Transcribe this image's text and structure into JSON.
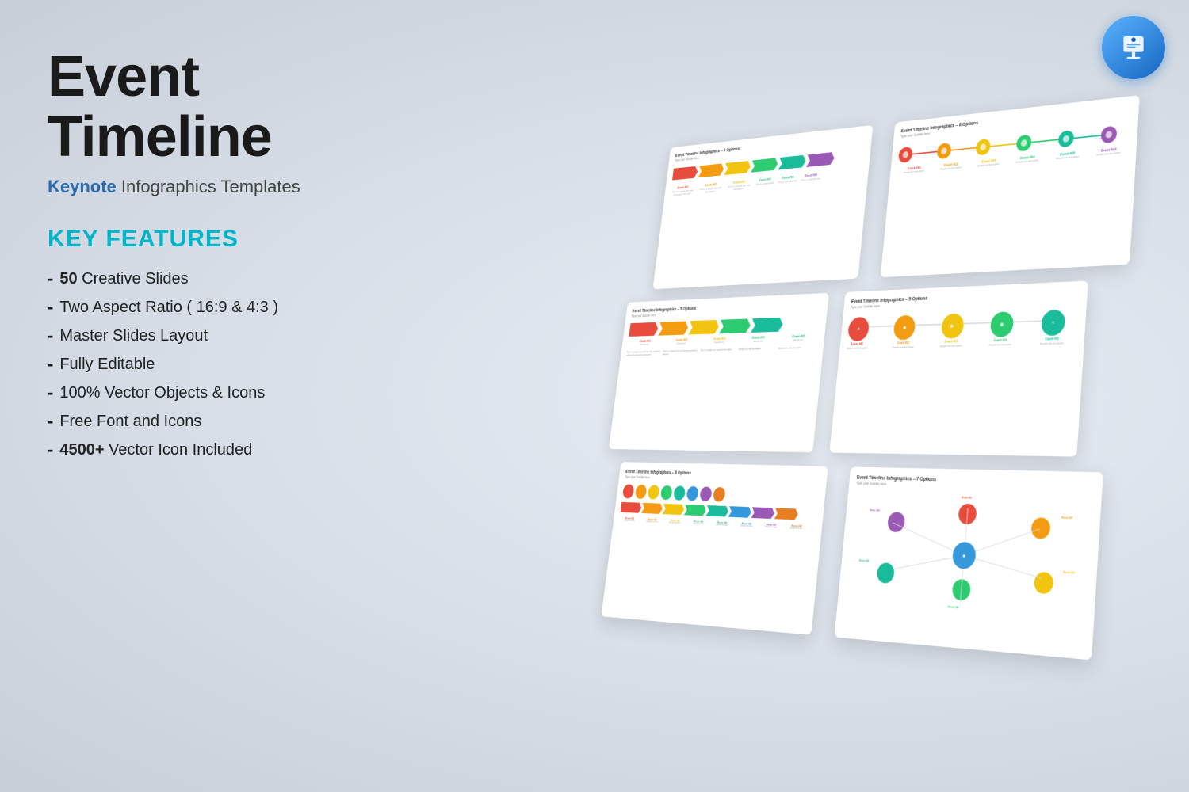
{
  "page": {
    "background": "#edf0f5"
  },
  "header": {
    "title": "Event Timeline",
    "subtitle_bold": "Keynote",
    "subtitle_rest": " Infographics Templates"
  },
  "features": {
    "section_title": "KEY FEATURES",
    "items": [
      {
        "dash": "-",
        "bold": "50",
        "text": " Creative Slides"
      },
      {
        "dash": "-",
        "bold": "",
        "text": "Two Aspect Ratio ( 16:9 & 4:3 )"
      },
      {
        "dash": "-",
        "bold": "",
        "text": "Master Slides Layout"
      },
      {
        "dash": "-",
        "bold": "",
        "text": "Fully Editable"
      },
      {
        "dash": "-",
        "bold": "",
        "text": "100% Vector Objects & Icons"
      },
      {
        "dash": "-",
        "bold": "",
        "text": "Free Font and Icons"
      },
      {
        "dash": "-",
        "bold": "4500+",
        "text": " Vector Icon Included"
      }
    ]
  },
  "slides": [
    {
      "id": "s1",
      "title": "Event Timeline Infographics – 6 Options",
      "subtitle": "Type your Subtitle here",
      "type": "arrow-chain",
      "colors": [
        "#e74c3c",
        "#f39c12",
        "#f1c40f",
        "#2ecc71",
        "#1abc9c",
        "#9b59b6"
      ]
    },
    {
      "id": "s2",
      "title": "Event Timeline Infographics – 6 Options",
      "subtitle": "Type your Subtitle here",
      "type": "dot-chain",
      "colors": [
        "#e74c3c",
        "#f39c12",
        "#f1c40f",
        "#2ecc71",
        "#1abc9c",
        "#9b59b6"
      ]
    },
    {
      "id": "s3",
      "title": "Event Timeline Infographics – 5 Options",
      "subtitle": "Type your Subtitle here",
      "type": "arrow-chain",
      "colors": [
        "#e74c3c",
        "#f39c12",
        "#f1c40f",
        "#2ecc71",
        "#1abc9c"
      ]
    },
    {
      "id": "s4",
      "title": "Event Timeline Infographics – 5 Options",
      "subtitle": "Type your Subtitle here",
      "type": "circle-chain",
      "colors": [
        "#e74c3c",
        "#f39c12",
        "#f1c40f",
        "#2ecc71",
        "#1abc9c"
      ]
    },
    {
      "id": "s5",
      "title": "Event Timeline Infographics – 8 Options",
      "subtitle": "Type your Subtitle here",
      "type": "mixed",
      "colors": [
        "#e74c3c",
        "#f39c12",
        "#f1c40f",
        "#2ecc71",
        "#1abc9c",
        "#3498db",
        "#9b59b6",
        "#e67e22"
      ]
    },
    {
      "id": "s6",
      "title": "Event Timeline Infographics – 7 Options",
      "subtitle": "Type your Subtitle here",
      "type": "flower",
      "colors": [
        "#e74c3c",
        "#f39c12",
        "#f1c40f",
        "#2ecc71",
        "#1abc9c",
        "#3498db",
        "#9b59b6"
      ]
    }
  ],
  "keynote_icon": {
    "label": "Keynote app icon"
  }
}
